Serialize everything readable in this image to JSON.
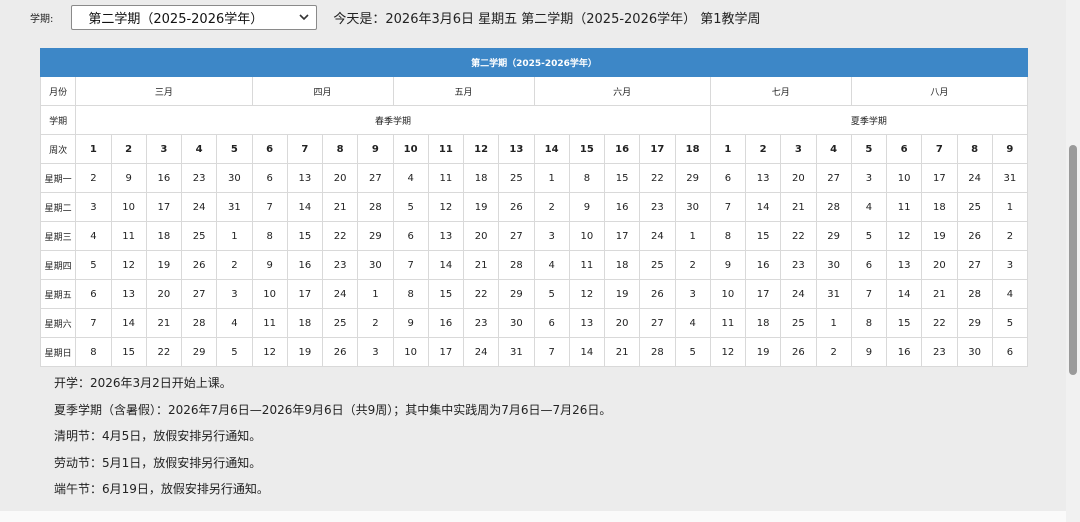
{
  "header": {
    "semester_label": "学期:",
    "semester_select": "第二学期（2025-2026学年）",
    "today_text": "今天是：2026年3月6日 星期五 第二学期（2025-2026学年） 第1教学周"
  },
  "calendar": {
    "title": "第二学期（2025-2026学年）",
    "month_label": "月份",
    "term_label": "学期",
    "week_label": "周次",
    "months": [
      {
        "name": "三月",
        "span": 5
      },
      {
        "name": "四月",
        "span": 4
      },
      {
        "name": "五月",
        "span": 4
      },
      {
        "name": "六月",
        "span": 5
      },
      {
        "name": "七月",
        "span": 4
      },
      {
        "name": "八月",
        "span": 5
      }
    ],
    "terms": [
      {
        "name": "春季学期",
        "span": 18
      },
      {
        "name": "夏季学期",
        "span": 9
      }
    ],
    "weeks": [
      "1",
      "2",
      "3",
      "4",
      "5",
      "6",
      "7",
      "8",
      "9",
      "10",
      "11",
      "12",
      "13",
      "14",
      "15",
      "16",
      "17",
      "18",
      "1",
      "2",
      "3",
      "4",
      "5",
      "6",
      "7",
      "8",
      "9"
    ],
    "weekday_rows": [
      {
        "label": "星期一",
        "weekend": false,
        "days": [
          "2",
          "9",
          "16",
          "23",
          "30",
          "6",
          "13",
          "20",
          "27",
          "4",
          "11",
          "18",
          "25",
          "1",
          "8",
          "15",
          "22",
          "29",
          "6",
          "13",
          "20",
          "27",
          "3",
          "10",
          "17",
          "24",
          "31"
        ]
      },
      {
        "label": "星期二",
        "weekend": false,
        "days": [
          "3",
          "10",
          "17",
          "24",
          "31",
          "7",
          "14",
          "21",
          "28",
          "5",
          "12",
          "19",
          "26",
          "2",
          "9",
          "16",
          "23",
          "30",
          "7",
          "14",
          "21",
          "28",
          "4",
          "11",
          "18",
          "25",
          "1"
        ]
      },
      {
        "label": "星期三",
        "weekend": false,
        "days": [
          "4",
          "11",
          "18",
          "25",
          "1",
          "8",
          "15",
          "22",
          "29",
          "6",
          "13",
          "20",
          "27",
          "3",
          "10",
          "17",
          "24",
          "1",
          "8",
          "15",
          "22",
          "29",
          "5",
          "12",
          "19",
          "26",
          "2"
        ]
      },
      {
        "label": "星期四",
        "weekend": false,
        "days": [
          "5",
          "12",
          "19",
          "26",
          "2",
          "9",
          "16",
          "23",
          "30",
          "7",
          "14",
          "21",
          "28",
          "4",
          "11",
          "18",
          "25",
          "2",
          "9",
          "16",
          "23",
          "30",
          "6",
          "13",
          "20",
          "27",
          "3"
        ]
      },
      {
        "label": "星期五",
        "weekend": false,
        "days": [
          "6",
          "13",
          "20",
          "27",
          "3",
          "10",
          "17",
          "24",
          "1",
          "8",
          "15",
          "22",
          "29",
          "5",
          "12",
          "19",
          "26",
          "3",
          "10",
          "17",
          "24",
          "31",
          "7",
          "14",
          "21",
          "28",
          "4"
        ]
      },
      {
        "label": "星期六",
        "weekend": true,
        "days": [
          "7",
          "14",
          "21",
          "28",
          "4",
          "11",
          "18",
          "25",
          "2",
          "9",
          "16",
          "23",
          "30",
          "6",
          "13",
          "20",
          "27",
          "4",
          "11",
          "18",
          "25",
          "1",
          "8",
          "15",
          "22",
          "29",
          "5"
        ]
      },
      {
        "label": "星期日",
        "weekend": true,
        "days": [
          "8",
          "15",
          "22",
          "29",
          "5",
          "12",
          "19",
          "26",
          "3",
          "10",
          "17",
          "24",
          "31",
          "7",
          "14",
          "21",
          "28",
          "5",
          "12",
          "19",
          "26",
          "2",
          "9",
          "16",
          "23",
          "30",
          "6"
        ]
      }
    ]
  },
  "notes": [
    "开学：2026年3月2日开始上课。",
    "夏季学期（含暑假）：2026年7月6日—2026年9月6日（共9周）；其中集中实践周为7月6日—7月26日。",
    "清明节：4月5日，放假安排另行通知。",
    "劳动节：5月1日，放假安排另行通知。",
    "端午节：6月19日，放假安排另行通知。"
  ],
  "colors": {
    "header_blue": "#3d87c7",
    "weekend_red": "#e02020"
  }
}
